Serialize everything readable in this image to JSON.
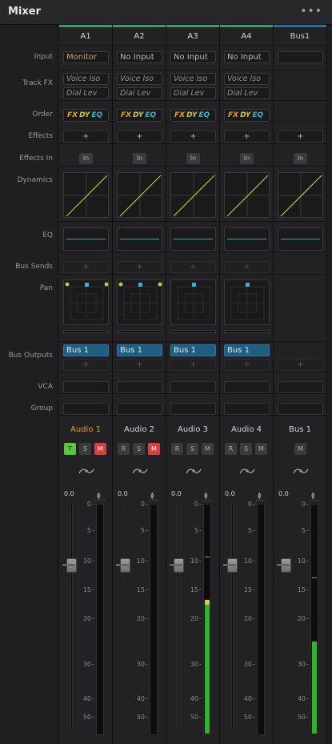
{
  "header": {
    "title": "Mixer",
    "menu_icon": "more-horizontal-icon"
  },
  "row_labels": {
    "input": "Input",
    "track_fx": "Track FX",
    "order": "Order",
    "effects": "Effects",
    "effects_in": "Effects In",
    "dynamics": "Dynamics",
    "eq": "EQ",
    "bus_sends": "Bus Sends",
    "pan": "Pan",
    "bus_outputs": "Bus Outputs",
    "vca": "VCA",
    "group": "Group"
  },
  "colors": {
    "track_bar": "#3e9a6a",
    "bus_bar": "#2a6fa0",
    "monitor": "#c8a25a",
    "meter_green": "#2ab82a"
  },
  "strips": [
    {
      "id": "A1",
      "input": "Monitor",
      "fx1": "Voice Iso",
      "fx2": "Dial Lev",
      "order": [
        "FX",
        "DY",
        "EQ"
      ],
      "effects": "+",
      "effects_in": "In",
      "bus_send": "+",
      "bus_output": "Bus 1",
      "bus_output_add": "+",
      "channel_name": "Audio 1",
      "buttons": [
        "T",
        "S",
        "M"
      ],
      "volume": "0.0",
      "meter_level": 0.0,
      "peak_level": null
    },
    {
      "id": "A2",
      "input": "No Input",
      "fx1": "Voice Iso",
      "fx2": "Dial Lev",
      "order": [
        "FX",
        "DY",
        "EQ"
      ],
      "effects": "+",
      "effects_in": "In",
      "bus_send": "+",
      "bus_output": "Bus 1",
      "bus_output_add": "+",
      "channel_name": "Audio 2",
      "buttons": [
        "R",
        "S",
        "M"
      ],
      "volume": "0.0",
      "meter_level": 0.0,
      "peak_level": null
    },
    {
      "id": "A3",
      "input": "No Input",
      "fx1": "Voice Iso",
      "fx2": "Dial Lev",
      "order": [
        "FX",
        "DY",
        "EQ"
      ],
      "effects": "+",
      "effects_in": "In",
      "bus_send": "+",
      "bus_output": "Bus 1",
      "bus_output_add": "+",
      "channel_name": "Audio 3",
      "buttons": [
        "R",
        "S",
        "M"
      ],
      "volume": "0.0",
      "meter_level": 0.56,
      "peak_level": 0.77
    },
    {
      "id": "A4",
      "input": "No Input",
      "fx1": "Voice Iso",
      "fx2": "Dial Lev",
      "order": [
        "FX",
        "DY",
        "EQ"
      ],
      "effects": "+",
      "effects_in": "In",
      "bus_send": "+",
      "bus_output": "Bus 1",
      "bus_output_add": "+",
      "channel_name": "Audio 4",
      "buttons": [
        "R",
        "S",
        "M"
      ],
      "volume": "0.0",
      "meter_level": 0.0,
      "peak_level": null
    },
    {
      "id": "Bus1",
      "input": "",
      "fx1": "",
      "fx2": "",
      "order": [],
      "effects": "+",
      "effects_in": "In",
      "bus_send": "",
      "bus_output": "",
      "bus_output_add": "+",
      "channel_name": "Bus 1",
      "buttons": [
        "M"
      ],
      "volume": "0.0",
      "meter_level": 0.4,
      "peak_level": 0.68
    }
  ],
  "fader_scale": [
    "0",
    "5",
    "10",
    "15",
    "20",
    "30",
    "40",
    "50"
  ]
}
